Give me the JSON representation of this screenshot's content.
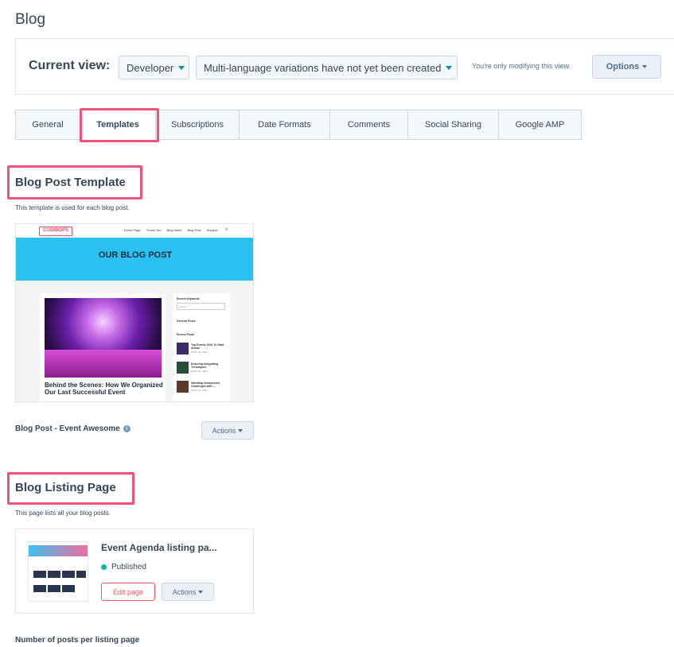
{
  "page": {
    "title": "Blog"
  },
  "view_bar": {
    "label": "Current view:",
    "developer_select": "Developer",
    "language_select": "Multi-language variations have not yet been created",
    "note": "You're only modifying this view.",
    "options_label": "Options"
  },
  "tabs": [
    {
      "label": "General",
      "active": false
    },
    {
      "label": "Templates",
      "active": true
    },
    {
      "label": "Subscriptions",
      "active": false
    },
    {
      "label": "Date Formats",
      "active": false
    },
    {
      "label": "Comments",
      "active": false
    },
    {
      "label": "Social Sharing",
      "active": false
    },
    {
      "label": "Google AMP",
      "active": false
    }
  ],
  "blog_post_template": {
    "title": "Blog Post Template",
    "description": "This template is used for each blog post.",
    "preview": {
      "logo": "CODIBOPS",
      "nav_links": [
        "Event Page",
        "Thank You",
        "Blog Index",
        "Blog Post",
        "Support"
      ],
      "hero_text": "OUR BLOG POST",
      "headline": "Behind the Scenes: How We Organized Our Last Successful Event",
      "sidebar": {
        "keywords_label": "Recent keywords",
        "search_placeholder": "Search",
        "general_posts_label": "General Posts",
        "recent_posts_label": "Recent Posts",
        "posts": [
          {
            "title": "Top Events 2024 To Start Ahead",
            "date": "March 05, 2024"
          },
          {
            "title": "Ensuring Integrating Techniques",
            "date": "March 01, 2024"
          },
          {
            "title": "Handling Unexpected Challenges with ...",
            "date": "March 02, 2024"
          }
        ]
      }
    },
    "template_name": "Blog Post - Event Awesome",
    "actions_label": "Actions"
  },
  "blog_listing_page": {
    "title": "Blog Listing Page",
    "description": "This page lists all your blog posts.",
    "card": {
      "title": "Event Agenda listing pa...",
      "status": "Published",
      "edit_label": "Edit page",
      "actions_label": "Actions"
    }
  },
  "posts_per_page": {
    "label": "Number of posts per listing page"
  },
  "colors": {
    "highlight": "#f0527b",
    "accent_teal": "#0091ae",
    "published_green": "#00bda5",
    "edit_red": "#f2545b"
  }
}
